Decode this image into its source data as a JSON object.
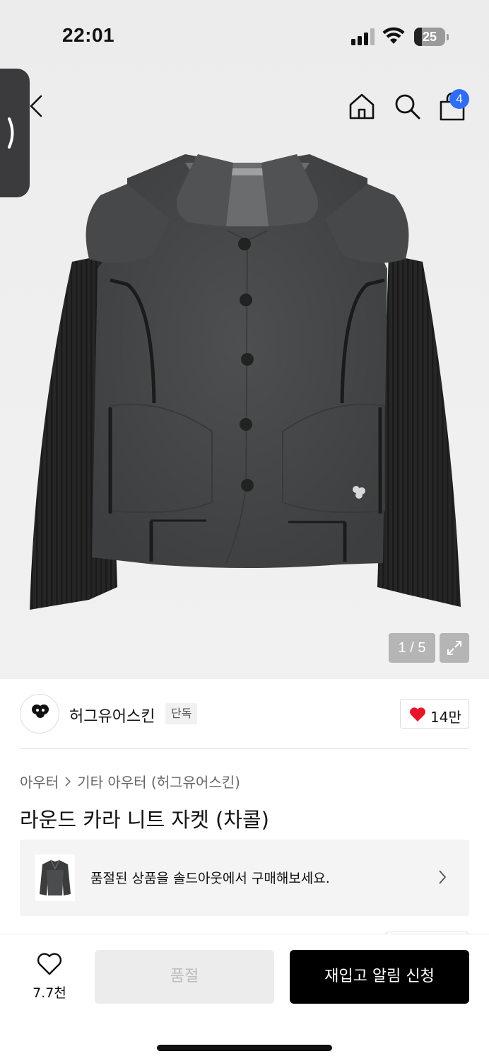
{
  "status_bar": {
    "time": "22:01",
    "battery": "25",
    "battery_level": 0.25
  },
  "header": {
    "cart_count": "4"
  },
  "gallery": {
    "pager": "1 / 5"
  },
  "brand": {
    "name": "허그유어스킨",
    "badge": "단독",
    "likes": "14만"
  },
  "product": {
    "breadcrumb": [
      "아우터",
      "기타 아우터 (허그유어스킨)"
    ],
    "title": "라운드 카라 니트 자켓 (차콜)"
  },
  "soldout_banner": {
    "text": "품절된 상품을 솔드아웃에서 구매해보세요."
  },
  "bottom_bar": {
    "wish_count": "7.7천",
    "soldout_label": "품절",
    "restock_label": "재입고 알림 신청"
  },
  "colors": {
    "accent_badge": "#2f6df6",
    "heart": "#e8152a",
    "primary_button": "#000000"
  }
}
